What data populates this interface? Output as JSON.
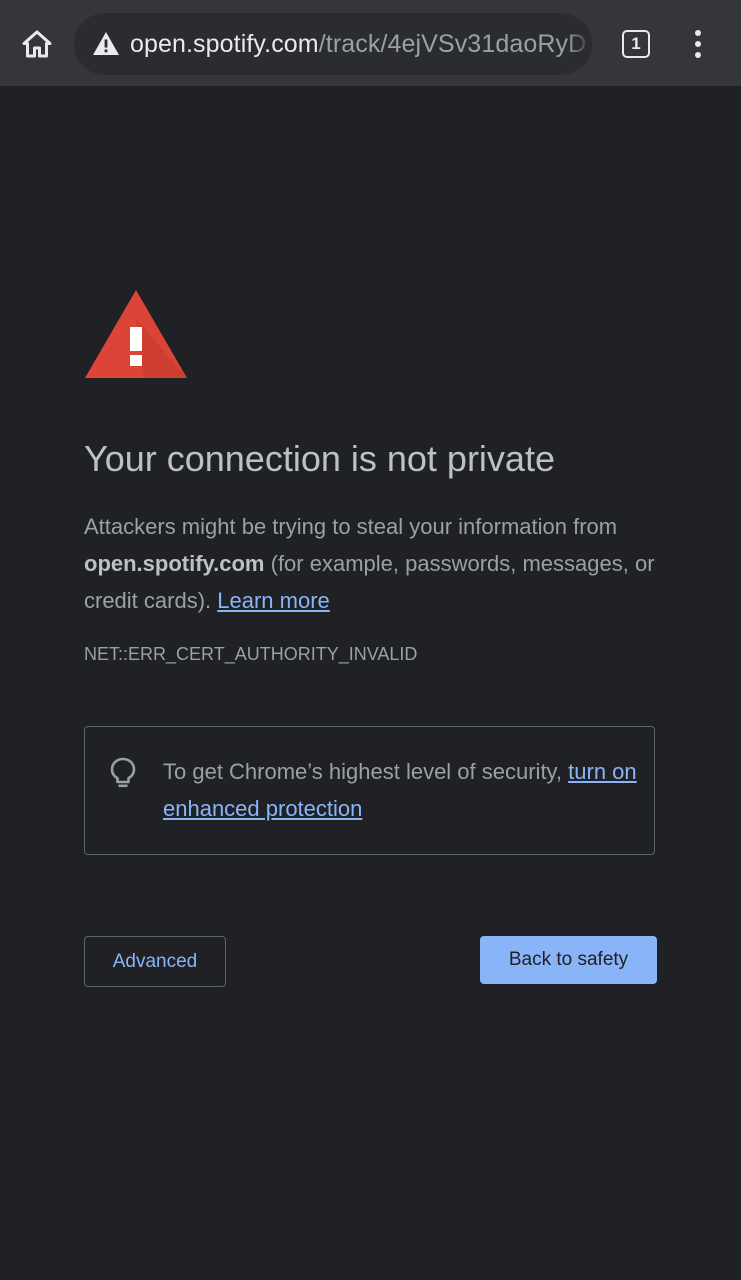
{
  "browser": {
    "url_host": "open.spotify.com",
    "url_path": "/track/4ejVSv31daoRyD",
    "tab_count": "1",
    "icons": {
      "home": "home-icon",
      "security": "not-secure-warning-icon",
      "tabs": "tab-switcher-icon",
      "menu": "more-vert-icon"
    }
  },
  "interstitial": {
    "icon": "red-warning-triangle-icon",
    "heading": "Your connection is not private",
    "explanation_intro": "Attackers might be trying to steal your information from ",
    "explanation_host": "open.spotify.com",
    "explanation_rest": " (for example, passwords, messages, or credit cards). ",
    "learn_more": "Learn more",
    "error_code": "NET::ERR_CERT_AUTHORITY_INVALID",
    "enhanced_icon": "lightbulb-icon",
    "enhanced_text": "To get Chrome’s highest level of security, ",
    "enhanced_link": "turn on enhanced protection",
    "advanced_label": "Advanced",
    "back_label": "Back to safety"
  },
  "colors": {
    "background": "#202124",
    "toolbar": "#35363a",
    "link": "#8ab4f8",
    "primary_button": "#8ab4f8",
    "warning_red": "#db4437"
  }
}
